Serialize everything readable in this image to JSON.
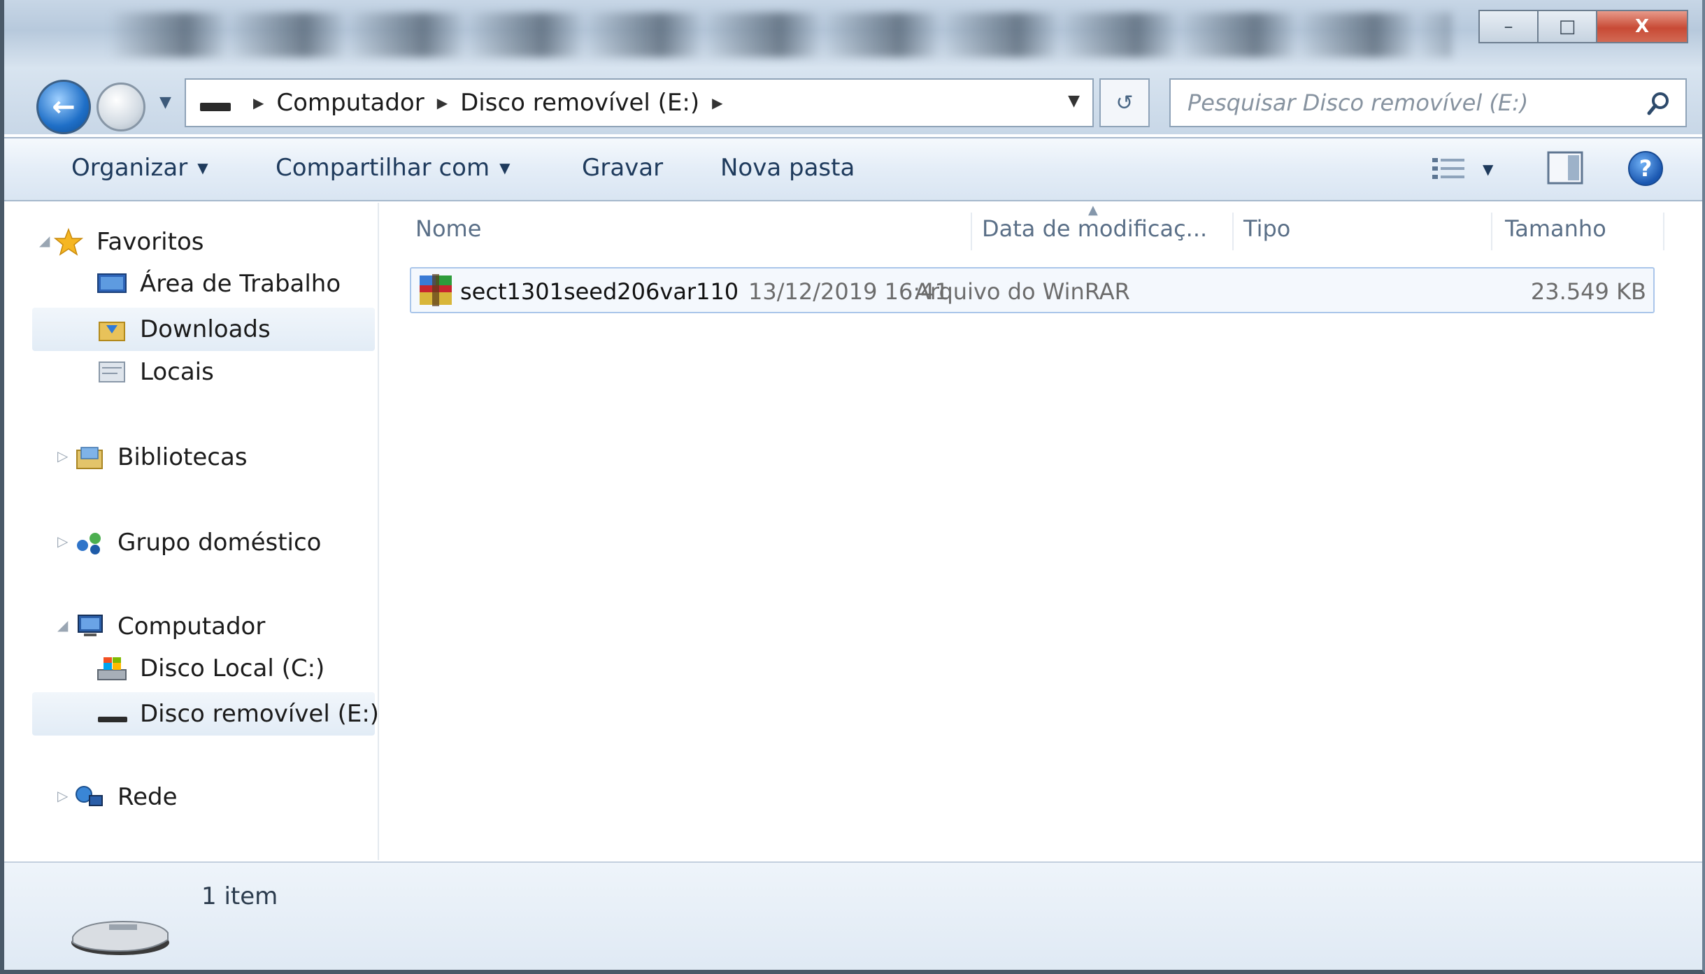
{
  "window": {
    "controls": {
      "minimize": "–",
      "maximize": "□",
      "close": "X"
    }
  },
  "address": {
    "crumbs": [
      "Computador",
      "Disco removível (E:)"
    ],
    "refresh_glyph": "↺"
  },
  "search": {
    "placeholder": "Pesquisar Disco removível (E:)"
  },
  "commands": {
    "organize": "Organizar",
    "share": "Compartilhar com",
    "burn": "Gravar",
    "new_folder": "Nova pasta",
    "help": "?"
  },
  "nav": {
    "favorites": "Favoritos",
    "desktop": "Área de Trabalho",
    "downloads": "Downloads",
    "places": "Locais",
    "libraries": "Bibliotecas",
    "homegroup": "Grupo doméstico",
    "computer": "Computador",
    "local_disk": "Disco Local (C:)",
    "removable": "Disco removível (E:)",
    "network": "Rede"
  },
  "columns": {
    "name": "Nome",
    "date": "Data de modificaç...",
    "type": "Tipo",
    "size": "Tamanho"
  },
  "files": [
    {
      "name": "sect1301seed206var110",
      "date": "13/12/2019 16:41",
      "type": "Arquivo do WinRAR",
      "size": "23.549 KB"
    }
  ],
  "status": {
    "count": "1 item"
  },
  "colors": {
    "accent": "#1f6fc7",
    "selection_border": "#aac6ea",
    "command_text": "#1e3a5c"
  }
}
